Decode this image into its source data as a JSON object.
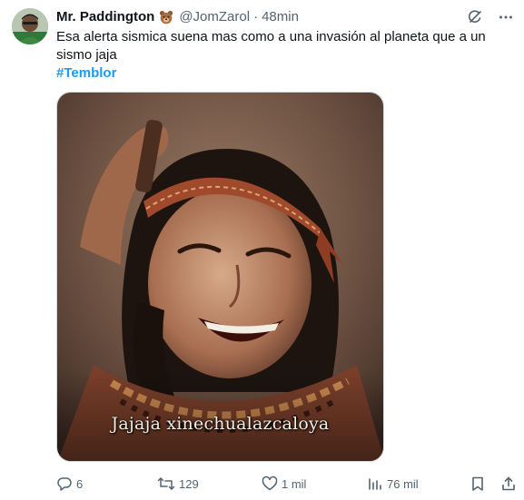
{
  "author": {
    "name": "Mr. Paddington",
    "badge_emoji": "bear-face",
    "handle": "@JomZarol",
    "separator": "·",
    "time": "48min"
  },
  "tweet": {
    "text": "Esa alerta sismica suena mas como a una invasión al planeta que a un sismo jaja",
    "hashtag": "#Temblor"
  },
  "media": {
    "caption": "Jajaja xinechualazcaloya"
  },
  "actions": {
    "replies": "6",
    "retweets": "129",
    "likes": "1 mil",
    "views": "76 mil"
  },
  "colors": {
    "accent": "#1d9bf0",
    "secondary_text": "#536471",
    "primary_text": "#0f1419"
  },
  "icons": [
    "grok-icon",
    "more-icon",
    "reply-icon",
    "retweet-icon",
    "like-icon",
    "views-icon",
    "bookmark-icon",
    "share-icon"
  ]
}
